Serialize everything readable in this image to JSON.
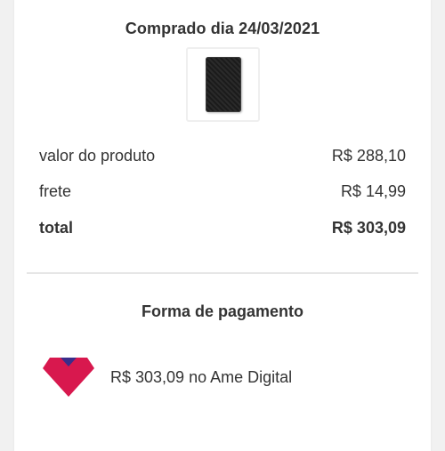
{
  "purchase": {
    "title": "Comprado dia 24/03/2021",
    "product_image": "external-hard-drive-image"
  },
  "summary": {
    "product_label": "valor do produto",
    "product_value": "R$ 288,10",
    "shipping_label": "frete",
    "shipping_value": "R$ 14,99",
    "total_label": "total",
    "total_value": "R$ 303,09"
  },
  "payment": {
    "title": "Forma de pagamento",
    "method_icon": "ame-digital-logo-icon",
    "method_text": "R$ 303,09 no Ame Digital"
  },
  "colors": {
    "ame_red": "#d8184e",
    "ame_blue": "#3a2d8a"
  }
}
